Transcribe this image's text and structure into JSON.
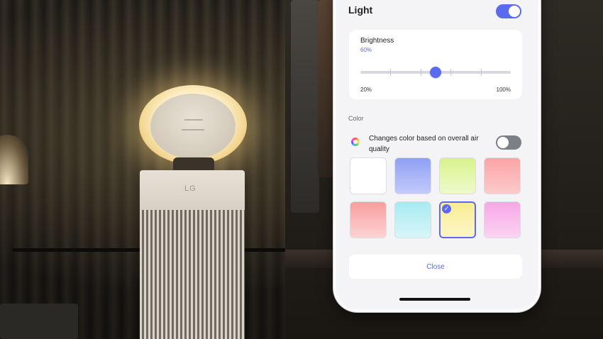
{
  "light": {
    "title": "Light",
    "enabled": true
  },
  "brightness": {
    "label": "Brightness",
    "value_text": "60%",
    "value": 60,
    "min_label": "20%",
    "max_label": "100%",
    "min": 20,
    "max": 100
  },
  "color": {
    "heading": "Color",
    "air_quality_label": "Changes color based on overall air quality",
    "air_quality_enabled": false,
    "swatches": [
      {
        "name": "white",
        "top": "#ffffff",
        "bottom": "#ffffff",
        "selected": false
      },
      {
        "name": "blue",
        "top": "#8fa0f3",
        "bottom": "#c3cafa",
        "selected": false
      },
      {
        "name": "lime",
        "top": "#d7f38e",
        "bottom": "#eefac9",
        "selected": false
      },
      {
        "name": "coral",
        "top": "#fba4a4",
        "bottom": "#fccaca",
        "selected": false
      },
      {
        "name": "salmon",
        "top": "#f99d9d",
        "bottom": "#fcd3d3",
        "selected": false
      },
      {
        "name": "aqua",
        "top": "#a8eaf2",
        "bottom": "#d7f6f9",
        "selected": false
      },
      {
        "name": "yellow",
        "top": "#f9ec93",
        "bottom": "#fcf6c8",
        "selected": true
      },
      {
        "name": "pink",
        "top": "#f7a7e6",
        "bottom": "#fbd3f2",
        "selected": false
      }
    ]
  },
  "close_label": "Close",
  "background": {
    "purifier_logo": "LG"
  },
  "colors": {
    "accent": "#5b6bf0",
    "toggle_off": "#7d7f86"
  }
}
